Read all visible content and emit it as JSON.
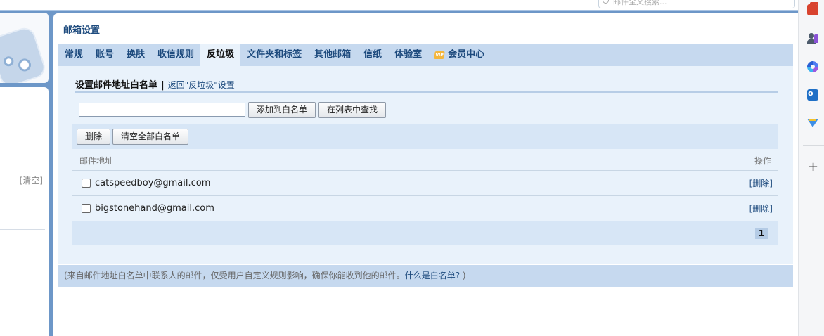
{
  "top": {
    "search_placeholder": "邮件全文搜索..."
  },
  "left": {
    "clear_label": "[清空]"
  },
  "main": {
    "title": "邮箱设置",
    "tabs": [
      {
        "label": "常规"
      },
      {
        "label": "账号"
      },
      {
        "label": "换肤"
      },
      {
        "label": "收信规则"
      },
      {
        "label": "反垃圾"
      },
      {
        "label": "文件夹和标签"
      },
      {
        "label": "其他邮箱"
      },
      {
        "label": "信纸"
      },
      {
        "label": "体验室"
      },
      {
        "label": "会员中心"
      }
    ],
    "active_tab": "反垃圾",
    "vip_badge": "VIP"
  },
  "whitelist": {
    "heading": "设置邮件地址白名单",
    "separator": "|",
    "back_link": "返回\"反垃圾\"设置",
    "input_value": "",
    "add_button": "添加到白名单",
    "find_button": "在列表中查找",
    "delete_button": "删除",
    "clear_all_button": "清空全部白名单",
    "col_address": "邮件地址",
    "col_action": "操作",
    "rows": [
      {
        "address": "catspeedboy@gmail.com",
        "action": "[删除]"
      },
      {
        "address": "bigstonehand@gmail.com",
        "action": "[删除]"
      }
    ],
    "page": "1",
    "note_text": "(来自邮件地址白名单中联系人的邮件，仅受用户自定义规则影响，确保你能收到他的邮件。",
    "note_link": "什么是白名单?",
    "note_end": " )"
  },
  "sidebar": {
    "icons": [
      "toolbox-icon",
      "people-chess-icon",
      "copilot-icon",
      "outlook-icon",
      "send-icon"
    ],
    "add_label": "+"
  }
}
